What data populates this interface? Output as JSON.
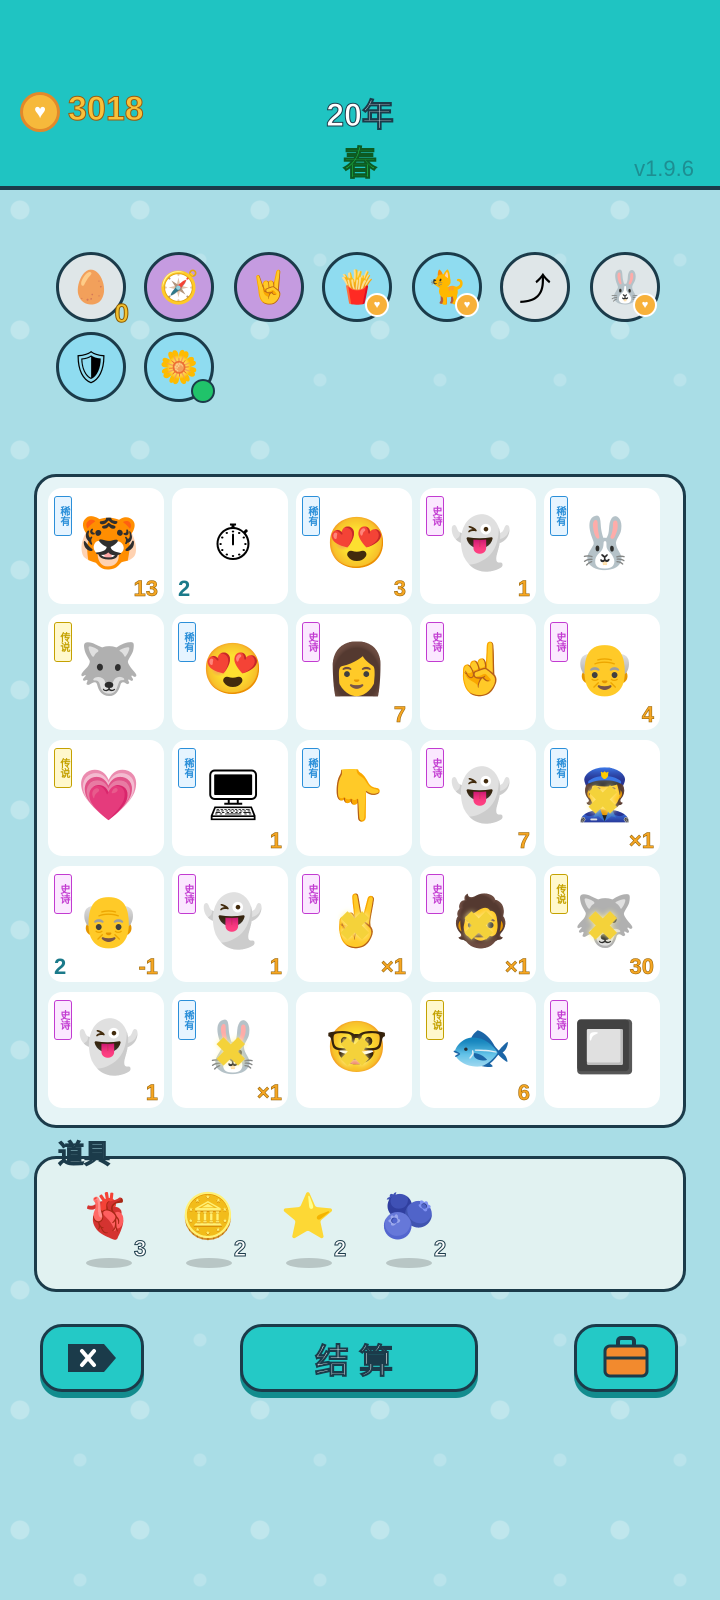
{
  "header": {
    "coins": "3018",
    "year": "20年",
    "season": "春",
    "version": "v1.9.6"
  },
  "relics": [
    {
      "icon": "egg-carton-icon",
      "badge": "0"
    },
    {
      "icon": "compass-icon",
      "badge": ""
    },
    {
      "icon": "rock-hand-icon",
      "badge": ""
    },
    {
      "icon": "fries-icon",
      "badge": ""
    },
    {
      "icon": "cat-icon",
      "badge": ""
    },
    {
      "icon": "arrow-card-icon",
      "badge": ""
    },
    {
      "icon": "rabbit-icon",
      "badge": ""
    },
    {
      "icon": "shield-wrench-icon",
      "badge": ""
    },
    {
      "icon": "potted-flower-icon",
      "badge": ""
    }
  ],
  "board": {
    "cells": [
      {
        "tag": "稀有",
        "icon": "tiger-icon",
        "count": "13",
        "left": ""
      },
      {
        "tag": "",
        "icon": "stopwatch-card-icon",
        "count": "",
        "left": "2"
      },
      {
        "tag": "稀有",
        "icon": "love-face-icon",
        "count": "3",
        "left": ""
      },
      {
        "tag": "史诗",
        "icon": "love-ghost-icon",
        "count": "1",
        "left": ""
      },
      {
        "tag": "稀有",
        "icon": "rabbit-drum-icon",
        "count": "",
        "left": ""
      },
      {
        "tag": "传说",
        "icon": "husky-king-icon",
        "count": "",
        "left": ""
      },
      {
        "tag": "稀有",
        "icon": "love-bald-icon",
        "count": "",
        "left": ""
      },
      {
        "tag": "史诗",
        "icon": "girl-icon",
        "count": "7",
        "left": ""
      },
      {
        "tag": "史诗",
        "icon": "grey-hand-icon",
        "count": "",
        "left": ""
      },
      {
        "tag": "史诗",
        "icon": "old-man-icon",
        "count": "4",
        "left": ""
      },
      {
        "tag": "传说",
        "icon": "heart-face-icon",
        "count": "",
        "left": ""
      },
      {
        "tag": "稀有",
        "icon": "server-icon",
        "count": "1",
        "left": ""
      },
      {
        "tag": "稀有",
        "icon": "brown-hand-icon",
        "count": "",
        "left": ""
      },
      {
        "tag": "史诗",
        "icon": "ghost-icon",
        "count": "7",
        "left": ""
      },
      {
        "tag": "稀有",
        "icon": "police-icon",
        "count": "×1",
        "left": ""
      },
      {
        "tag": "史诗",
        "icon": "grandpa-icon",
        "count": "-1",
        "left": "2"
      },
      {
        "tag": "史诗",
        "icon": "ghost-icon",
        "count": "1",
        "left": ""
      },
      {
        "tag": "史诗",
        "icon": "peace-hand-icon",
        "count": "×1",
        "left": ""
      },
      {
        "tag": "史诗",
        "icon": "green-hat-icon",
        "count": "×1",
        "left": ""
      },
      {
        "tag": "传说",
        "icon": "husky-heart-icon",
        "count": "30",
        "left": ""
      },
      {
        "tag": "史诗",
        "icon": "ghost-icon",
        "count": "1",
        "left": ""
      },
      {
        "tag": "稀有",
        "icon": "rabbit-drum-icon",
        "count": "×1",
        "left": ""
      },
      {
        "tag": "",
        "icon": "glasses-man-icon",
        "count": "",
        "left": ""
      },
      {
        "tag": "传说",
        "icon": "koi-fish-icon",
        "count": "6",
        "left": ""
      },
      {
        "tag": "史诗",
        "icon": "gpu-icon",
        "count": "",
        "left": ""
      }
    ]
  },
  "items": {
    "label": "道具",
    "list": [
      {
        "icon": "liver-icon",
        "qty": "3"
      },
      {
        "icon": "dollar-coin-icon",
        "qty": "2"
      },
      {
        "icon": "star-icon",
        "qty": "2"
      },
      {
        "icon": "blueberry-icon",
        "qty": "2"
      }
    ]
  },
  "buttons": {
    "settle": "结算"
  },
  "colors": {
    "header": "#1fc4c2",
    "accent": "#24c9c6",
    "coin": "#f8c13a"
  }
}
